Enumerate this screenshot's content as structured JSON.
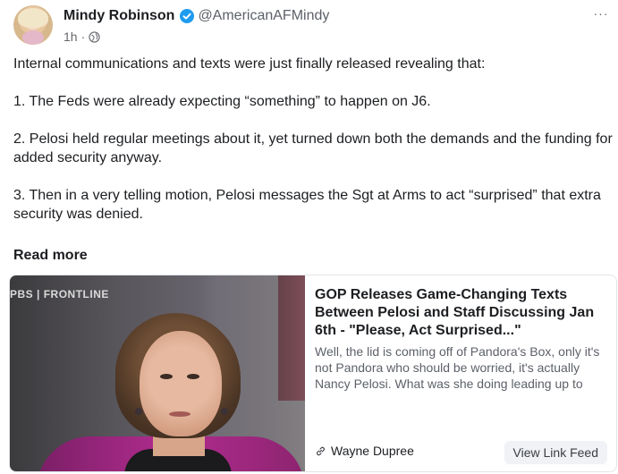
{
  "post": {
    "author": {
      "name": "Mindy Robinson",
      "handle": "@AmericanAFMindy",
      "verified": true,
      "time": "1h",
      "visibility_icon": "globe-icon"
    },
    "text": {
      "intro": "Internal communications and texts were just finally released revealing that:",
      "point1": "1. The Feds were already expecting “something” to happen on J6.",
      "point2": "2. Pelosi held regular meetings about it, yet turned down both the demands and the funding for added security anyway.",
      "point3": "3. Then in a very telling motion, Pelosi messages the Sgt at Arms to act “surprised” that extra security was denied."
    },
    "read_more": "Read more",
    "more_menu_label": "···",
    "link_card": {
      "thumbnail_badge": "PBS | FRONTLINE",
      "title": "GOP Releases Game-Changing Texts Between Pelosi and Staff Discussing Jan 6th - \"Please, Act Surprised...\"",
      "description": "Well, the lid is coming off of Pandora's Box, only it's not Pandora who should be worried, it's actually Nancy Pelosi. What was she doing leading up to",
      "source": "Wayne Dupree",
      "button_label": "View Link Feed"
    }
  },
  "colors": {
    "verified_blue": "#1d9bf0",
    "text_primary": "#1c1e21",
    "text_secondary": "#65676b",
    "card_border": "#e3e5e8",
    "button_bg": "#f0f2f5"
  }
}
